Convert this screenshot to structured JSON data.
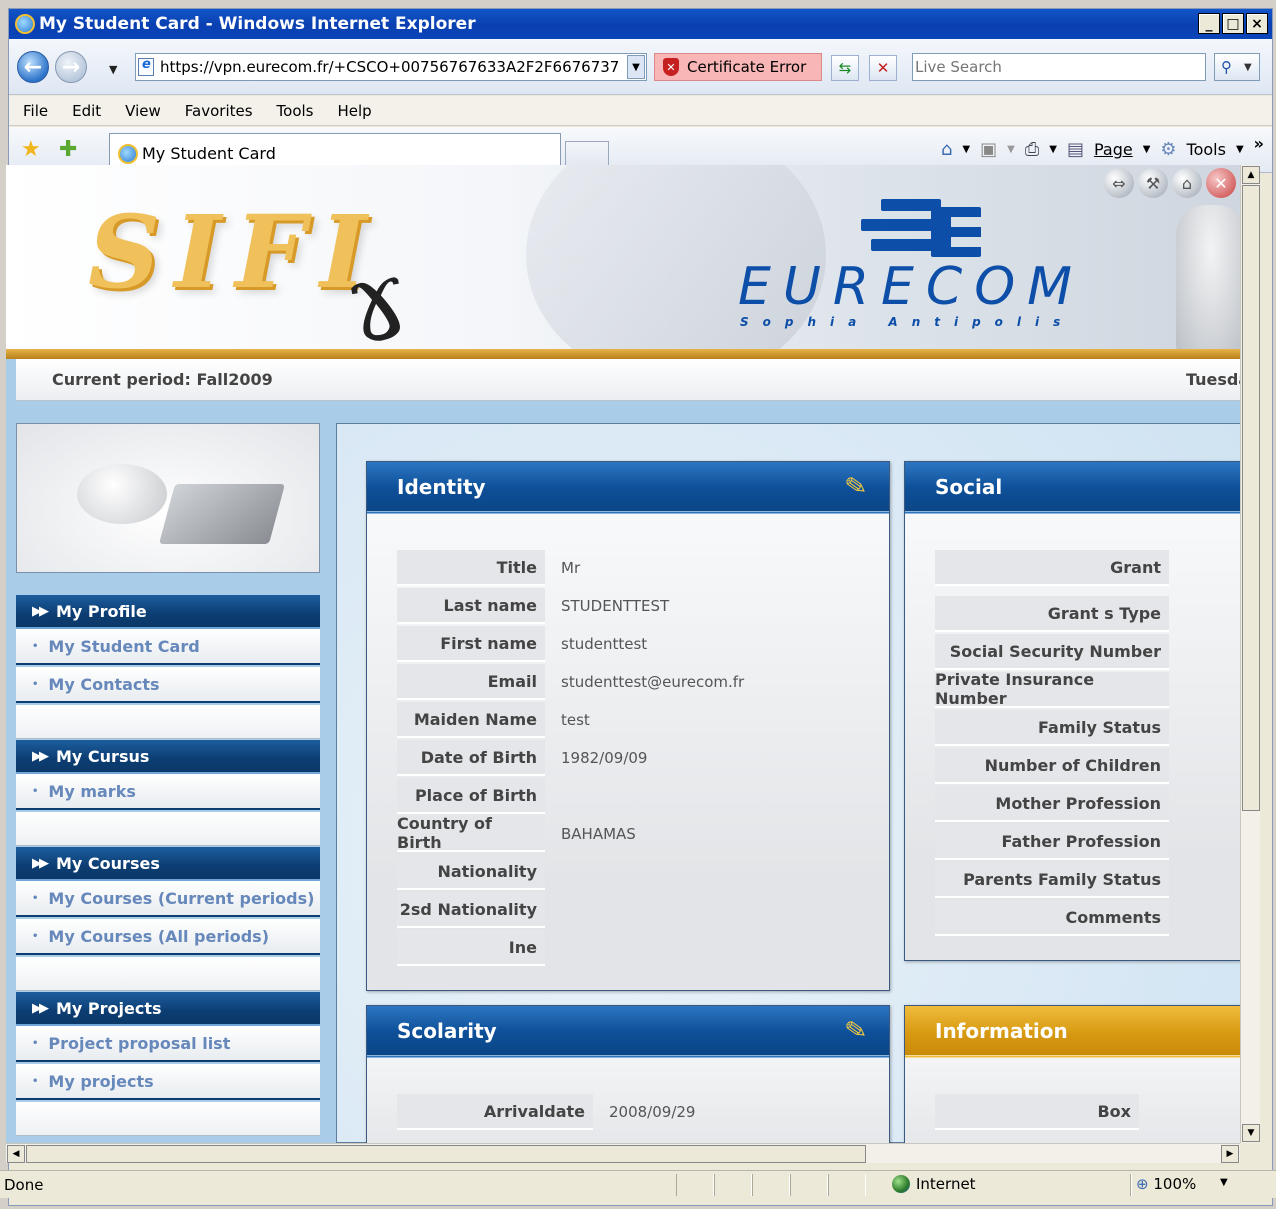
{
  "window": {
    "title": "My Student Card - Windows Internet Explorer",
    "min_label": "_",
    "max_label": "□",
    "close_label": "×"
  },
  "address": {
    "url": "https://vpn.eurecom.fr/+CSCO+00756767633A2F2F6676737",
    "cert_error": "Certificate Error",
    "search_placeholder": "Live Search"
  },
  "menu": [
    "File",
    "Edit",
    "View",
    "Favorites",
    "Tools",
    "Help"
  ],
  "favbar": {
    "tab_title": "My Student Card",
    "page_label": "Page",
    "tools_label": "Tools"
  },
  "page": {
    "logo_text": "SIFI",
    "brand": "EURECOM",
    "brand_sub": "Sophia Antipolis",
    "current_period": "Current period: Fall2009",
    "date_partial": "Tuesda",
    "sidebar": {
      "sections": [
        {
          "title": "My Profile",
          "items": [
            "My Student Card",
            "My Contacts"
          ]
        },
        {
          "title": "My Cursus",
          "items": [
            "My marks"
          ]
        },
        {
          "title": "My Courses",
          "items": [
            "My Courses (Current periods)",
            "My Courses (All periods)"
          ]
        },
        {
          "title": "My Projects",
          "items": [
            "Project proposal list",
            "My projects"
          ]
        }
      ]
    },
    "identity": {
      "title": "Identity",
      "rows": [
        {
          "label": "Title",
          "value": "Mr"
        },
        {
          "label": "Last name",
          "value": "STUDENTTEST"
        },
        {
          "label": "First name",
          "value": "studenttest"
        },
        {
          "label": "Email",
          "value": "studenttest@eurecom.fr"
        },
        {
          "label": "Maiden Name",
          "value": "test"
        },
        {
          "label": "Date of Birth",
          "value": "1982/09/09"
        },
        {
          "label": "Place of Birth",
          "value": ""
        },
        {
          "label": "Country of Birth",
          "value": "BAHAMAS"
        },
        {
          "label": "Nationality",
          "value": ""
        },
        {
          "label": "2sd Nationality",
          "value": ""
        },
        {
          "label": "Ine",
          "value": ""
        }
      ]
    },
    "social": {
      "title": "Social",
      "rows": [
        "Grant",
        "Grant s Type",
        "Social Security Number",
        "Private Insurance Number",
        "Family Status",
        "Number of Children",
        "Mother Profession",
        "Father Profession",
        "Parents Family Status",
        "Comments"
      ]
    },
    "scolarity": {
      "title": "Scolarity",
      "rows": [
        {
          "label": "Arrivaldate",
          "value": "2008/09/29"
        }
      ]
    },
    "information": {
      "title": "Information",
      "rows": [
        "Box"
      ]
    }
  },
  "status": {
    "text": "Done",
    "zone": "Internet",
    "zoom": "100%"
  },
  "colors": {
    "title_bar": "#0a3fb0",
    "panel_header": "#0d4f98",
    "info_header": "#d89a12",
    "menu_link": "#6688bb"
  }
}
